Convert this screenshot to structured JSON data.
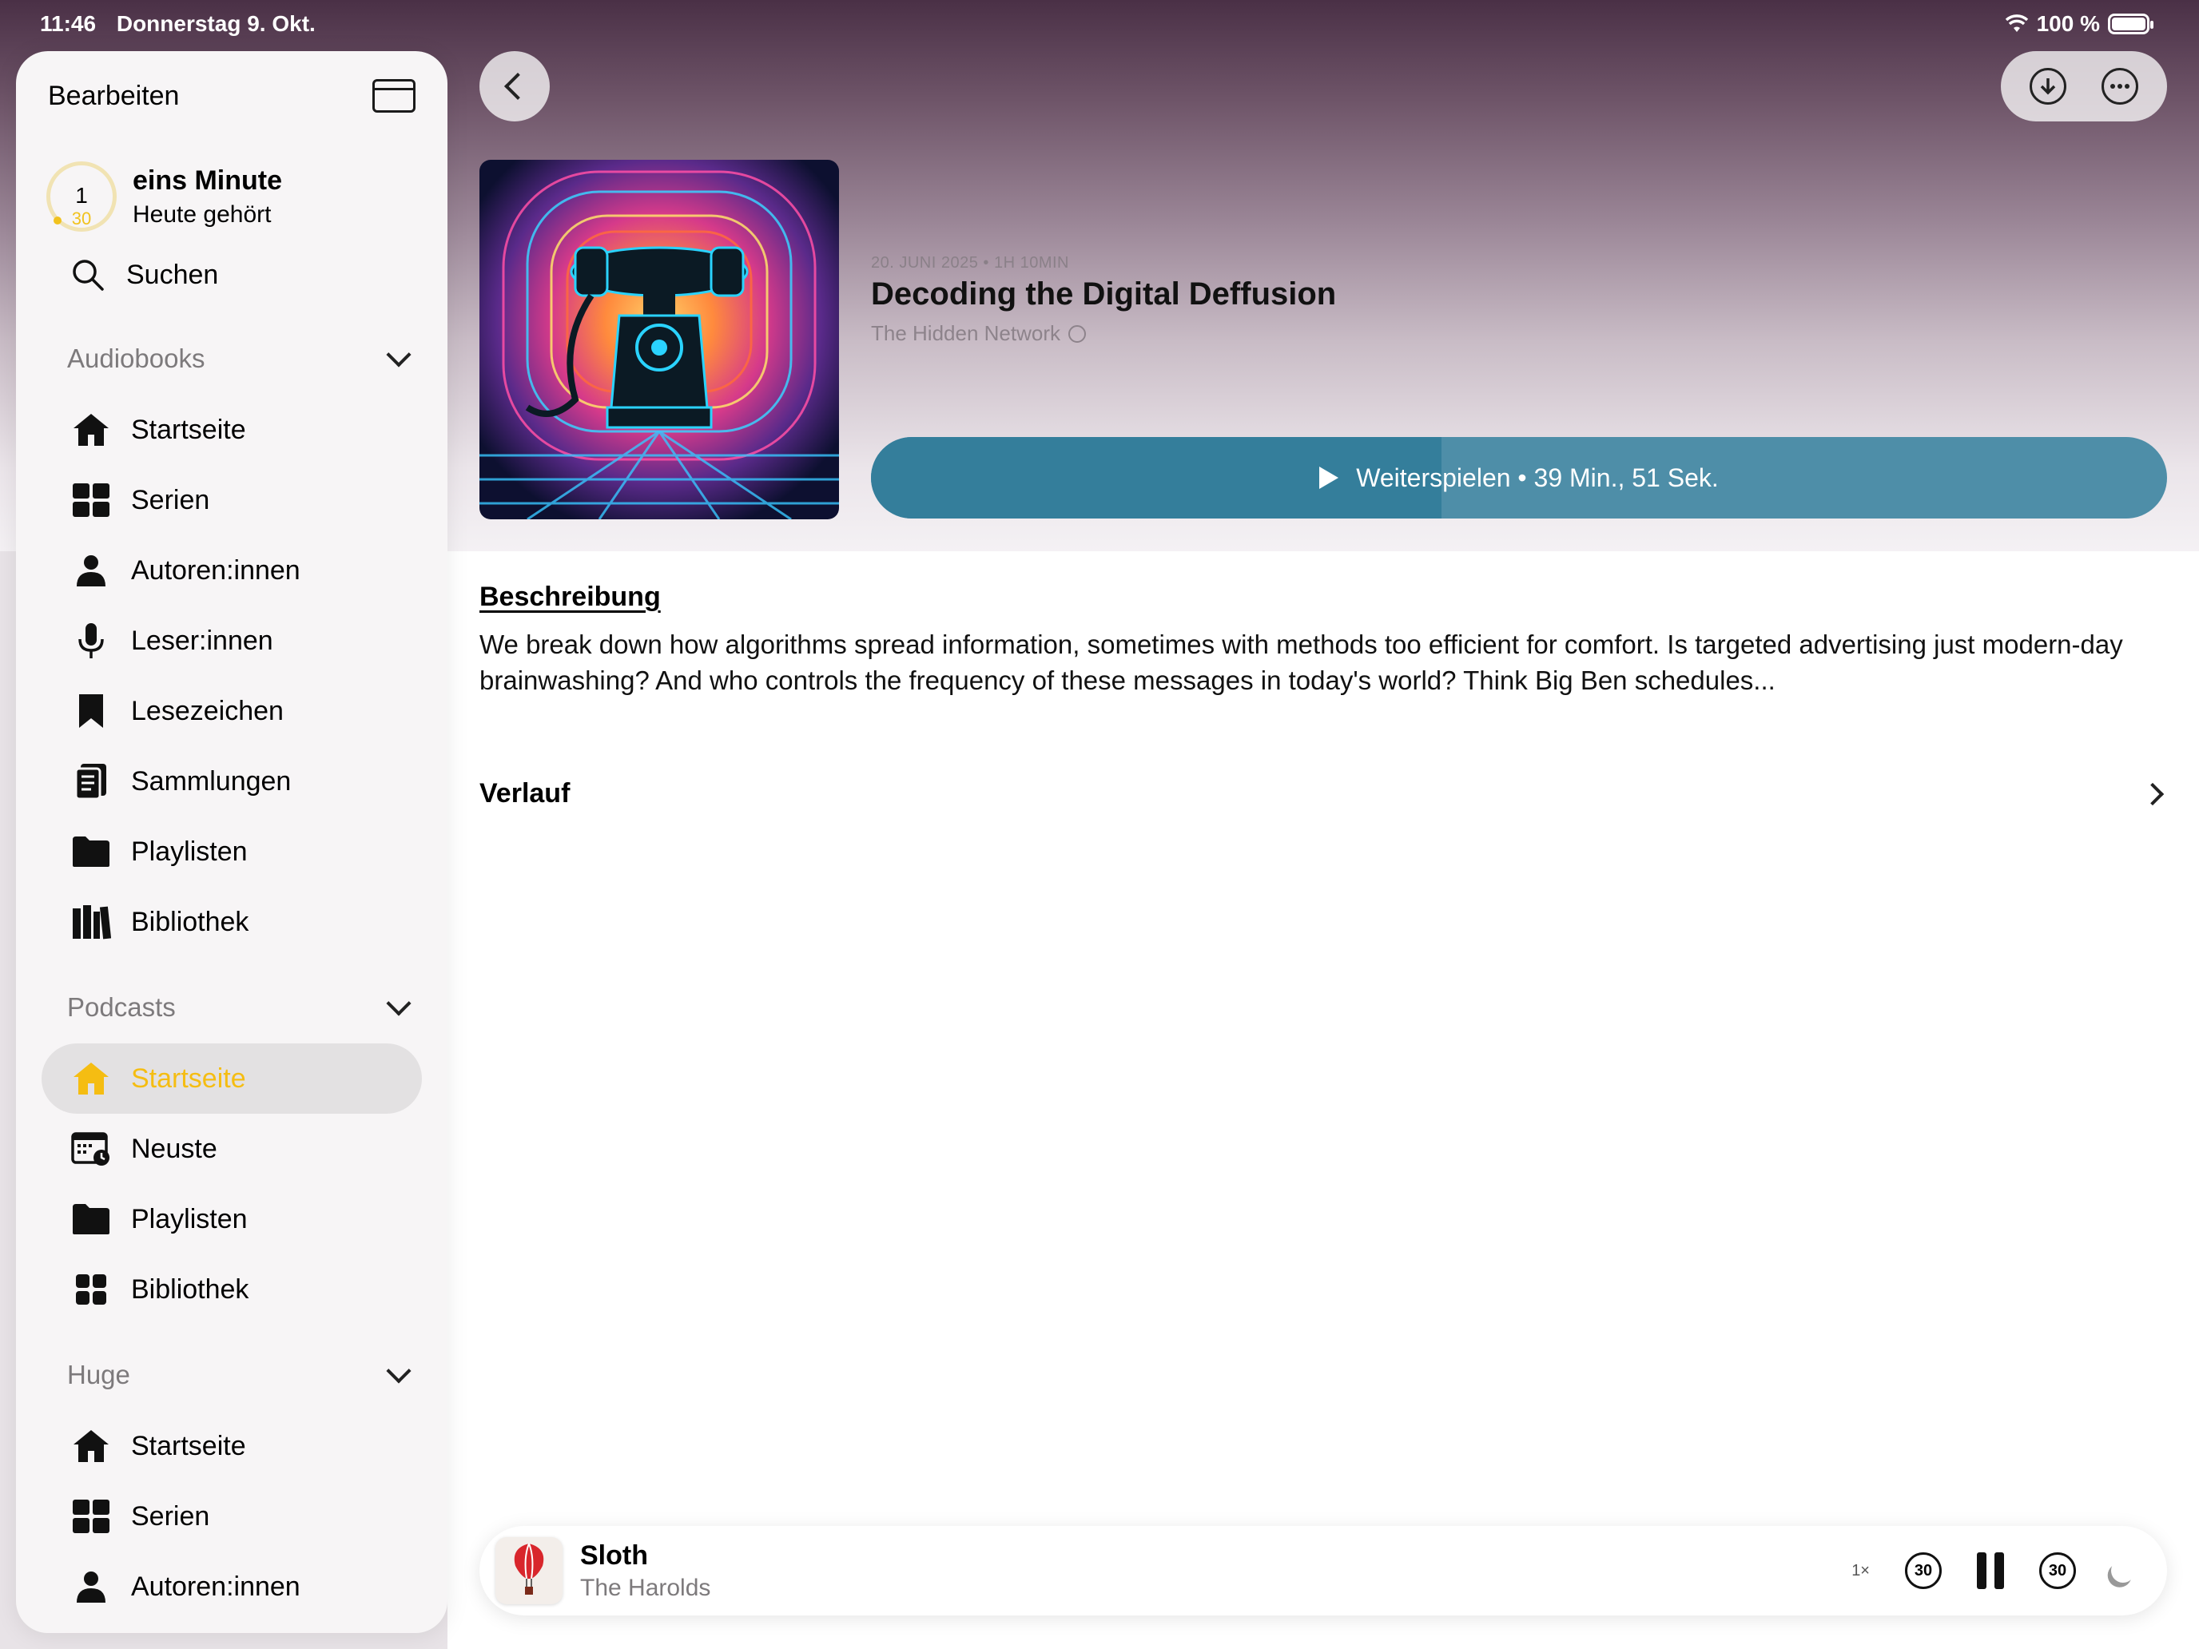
{
  "status": {
    "time": "11:46",
    "date": "Donnerstag 9. Okt.",
    "battery": "100 %"
  },
  "sidebar": {
    "edit": "Bearbeiten",
    "goal": {
      "top": "1",
      "bottom": "30",
      "title": "eins Minute",
      "subtitle": "Heute gehört"
    },
    "search": "Suchen",
    "sections": [
      {
        "title": "Audiobooks",
        "items": [
          "Startseite",
          "Serien",
          "Autoren:innen",
          "Leser:innen",
          "Lesezeichen",
          "Sammlungen",
          "Playlisten",
          "Bibliothek"
        ]
      },
      {
        "title": "Podcasts",
        "items": [
          "Startseite",
          "Neuste",
          "Playlisten",
          "Bibliothek"
        ]
      },
      {
        "title": "Huge",
        "items": [
          "Startseite",
          "Serien",
          "Autoren:innen"
        ]
      }
    ]
  },
  "episode": {
    "meta": "20. JUNI 2025 • 1H 10MIN",
    "title": "Decoding the Digital Deffusion",
    "show": "The Hidden Network",
    "play_label": "Weiterspielen • 39 Min., 51 Sek.",
    "progress": 0.44
  },
  "content": {
    "description_header": "Beschreibung",
    "description": "We break down how algorithms spread information, sometimes with methods too efficient for comfort. Is targeted advertising just modern-day brainwashing? And who controls the frequency of these messages in today's world? Think Big Ben schedules...",
    "history": "Verlauf"
  },
  "player": {
    "title": "Sloth",
    "artist": "The Harolds",
    "speed": "1×",
    "skip_back": "30",
    "skip_fwd": "30"
  },
  "colors": {
    "accent": "#f5bd12",
    "play": "#347e9b"
  }
}
